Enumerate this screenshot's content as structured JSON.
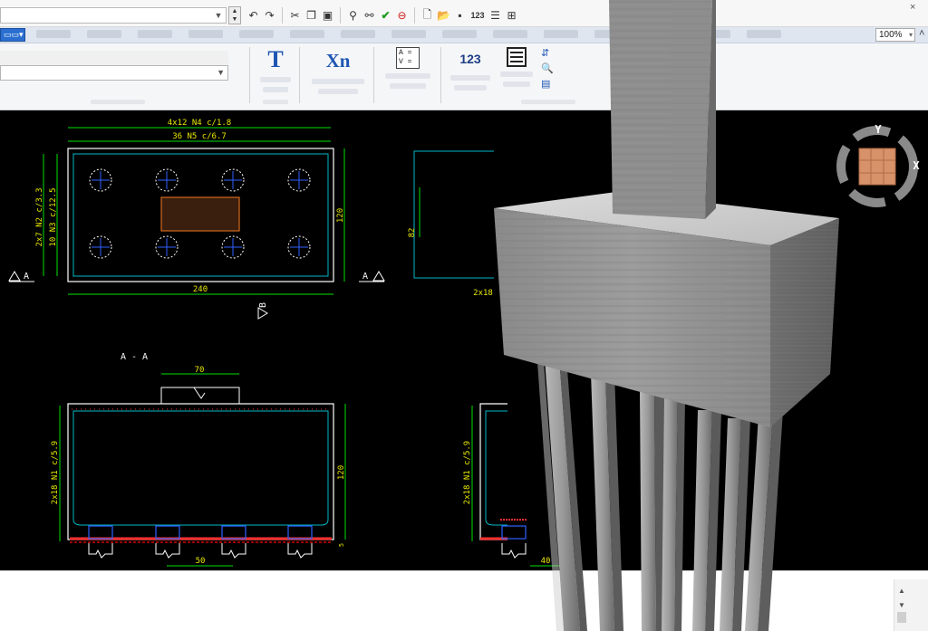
{
  "toolbar": {
    "combo_value": "",
    "icons": [
      "spin-updown",
      "undo",
      "redo",
      "cut",
      "copy",
      "paste",
      "find",
      "find-replace",
      "check",
      "cancel",
      "new-file",
      "open-folder",
      "save",
      "123",
      "table-list",
      "print-preview"
    ],
    "close_label": "×"
  },
  "tabs": {
    "dropdown_label": "▾",
    "zoom_value": "100%",
    "zoom_arrow": "▾",
    "collapse_label": "˄"
  },
  "ribbon": {
    "text_button_glyph": "T",
    "xn_button_glyph": "Xn",
    "av_button_glyph_a": "A =",
    "av_button_glyph_v": "V =",
    "numbers_button_glyph": "123",
    "small_icons": [
      "sort-icon",
      "zoom-icon",
      "panel-icon"
    ]
  },
  "drawing": {
    "plan": {
      "dim_top_1": "4x12  N4  c/1.8",
      "dim_top_2": "36  N5  c/6.7",
      "dim_left_1": "2x7  N2  c/3.3",
      "dim_left_2": "10  N3  c/12.5",
      "dim_right": "120",
      "dim_bottom": "240",
      "section_a_left": "A",
      "section_a_right": "A",
      "section_b": "B"
    },
    "side": {
      "dim_left": "82",
      "dim_bottom": "2x18"
    },
    "section_aa": {
      "title": "A  -  A",
      "dim_top": "70",
      "dim_left": "2x18  N1  c/5.9",
      "dim_right": "120",
      "dim_right_small": "5",
      "dim_bottom": "50"
    },
    "section_bb": {
      "dim_left": "2x18  N1  c/5.9",
      "dim_bottom": "40"
    },
    "viewcube": {
      "axis_y": "Y",
      "axis_x": "X"
    }
  },
  "colors": {
    "canvas_bg": "#000000",
    "outline": "#ffffff",
    "dimension": "#00e000",
    "rebar": "#00b8c8",
    "column": "#d2691e",
    "dim_text": "#e8e800",
    "pile": "#3060ff",
    "accent_blue": "#2a6fd0"
  }
}
